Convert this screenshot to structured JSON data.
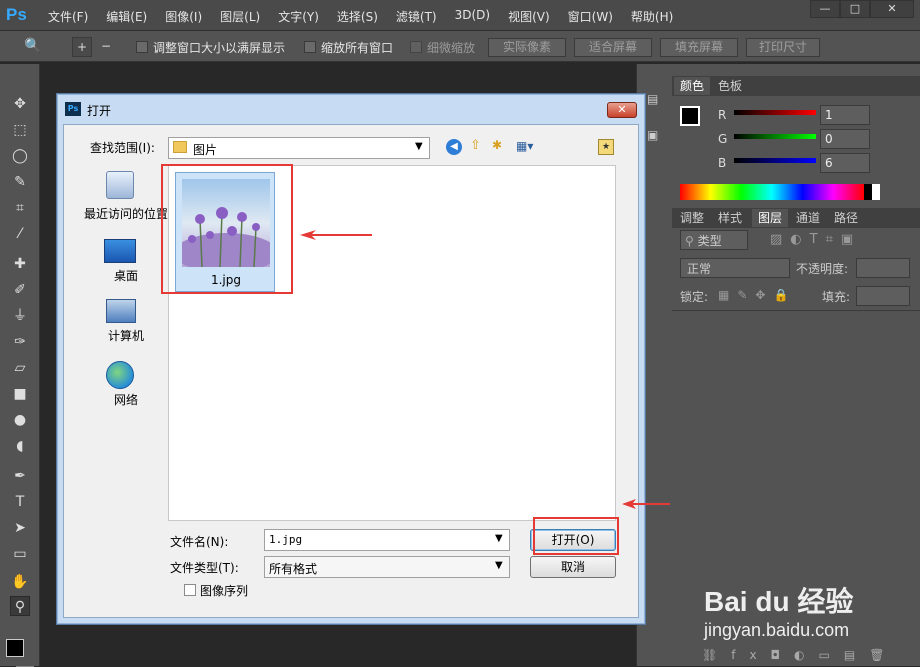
{
  "app": {
    "logo": "Ps"
  },
  "menu": [
    "文件(F)",
    "编辑(E)",
    "图像(I)",
    "图层(L)",
    "文字(Y)",
    "选择(S)",
    "滤镜(T)",
    "3D(D)",
    "视图(V)",
    "窗口(W)",
    "帮助(H)"
  ],
  "window_controls": {
    "minimize": "—",
    "restore": "□",
    "close": "✕"
  },
  "options_bar": {
    "resize_window": "调整窗口大小以满屏显示",
    "zoom_all": "缩放所有窗口",
    "scrubby_zoom": "细微缩放",
    "actual_pixels": "实际像素",
    "fit_screen": "适合屏幕",
    "fill_screen": "填充屏幕",
    "print_size": "打印尺寸"
  },
  "color_panel": {
    "tabs": [
      "颜色",
      "色板"
    ],
    "r_label": "R",
    "g_label": "G",
    "b_label": "B",
    "r": "1",
    "g": "0",
    "b": "6"
  },
  "layers_panel": {
    "tabs": [
      "调整",
      "样式",
      "图层",
      "通道",
      "路径"
    ],
    "kind": "类型",
    "blend": "正常",
    "opacity_label": "不透明度:",
    "lock_label": "锁定:",
    "fill_label": "填充:"
  },
  "dialog": {
    "title": "打开",
    "look_in_label": "查找范围(I):",
    "look_in_value": "图片",
    "places": [
      "最近访问的位置",
      "桌面",
      "计算机",
      "网络"
    ],
    "file": {
      "name": "1.jpg"
    },
    "filename_label": "文件名(N):",
    "filename_value": "1.jpg",
    "filetype_label": "文件类型(T):",
    "filetype_value": "所有格式",
    "open_button": "打开(O)",
    "cancel_button": "取消",
    "image_sequence": "图像序列"
  },
  "watermark": {
    "brand": "Bai du 经验",
    "url": "jingyan.baidu.com"
  },
  "colors": {
    "accent_red": "#e53935",
    "ps_blue": "#37aaff"
  }
}
